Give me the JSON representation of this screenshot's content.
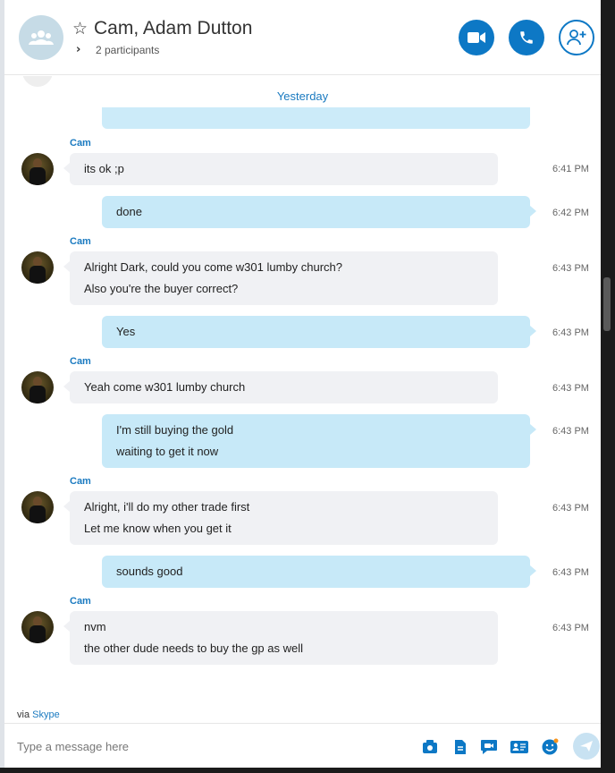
{
  "header": {
    "title": "Cam, Adam Dutton",
    "participants": "2 participants"
  },
  "conversation": {
    "date_separator": "Yesterday",
    "messages": [
      {
        "sender": "Cam",
        "lines": [
          "its ok ;p"
        ],
        "time": "6:41 PM"
      },
      {
        "lines": [
          "done"
        ],
        "time": "6:42 PM"
      },
      {
        "sender": "Cam",
        "lines": [
          "Alright Dark, could you come w301 lumby church?",
          "Also you're the buyer correct?"
        ],
        "time": "6:43 PM"
      },
      {
        "lines": [
          "Yes"
        ],
        "time": "6:43 PM"
      },
      {
        "sender": "Cam",
        "lines": [
          "Yeah come w301 lumby church"
        ],
        "time": "6:43 PM"
      },
      {
        "lines": [
          "I'm still buying the gold",
          "waiting to get it now"
        ],
        "time": "6:43 PM"
      },
      {
        "sender": "Cam",
        "lines": [
          "Alright, i'll do my other trade first",
          "Let me know when you get it"
        ],
        "time": "6:43 PM"
      },
      {
        "lines": [
          "sounds good"
        ],
        "time": "6:43 PM"
      },
      {
        "sender": "Cam",
        "lines": [
          "nvm",
          "the other dude needs to buy the gp as well"
        ],
        "time": "6:43 PM"
      }
    ]
  },
  "footer": {
    "via_prefix": "via",
    "via_link": "Skype",
    "composer_placeholder": "Type a message here"
  },
  "colors": {
    "accent": "#0d78c5",
    "outgoing_bubble": "#c7e9f8",
    "incoming_bubble": "#f0f1f4",
    "link": "#1a7ac0"
  }
}
